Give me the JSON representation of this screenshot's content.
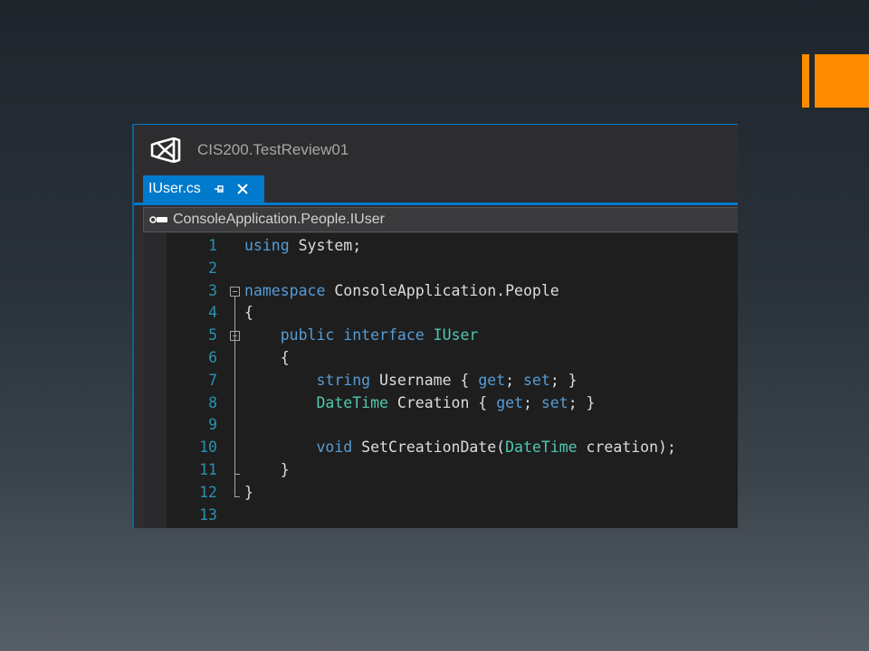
{
  "colors": {
    "accent": "#ff8c00",
    "keyword": "#569cd6",
    "type": "#4ec9b0",
    "line_number": "#2b91af",
    "text": "#dcdcdc",
    "tab_active": "#007acc"
  },
  "window": {
    "title": "CIS200.TestReview01",
    "logo_icon": "visual-studio-logo-icon"
  },
  "tab": {
    "label": "IUser.cs",
    "pin_icon": "pin-icon",
    "close_icon": "close-icon"
  },
  "nav": {
    "icon": "interface-icon",
    "path": "ConsoleApplication.People.IUser"
  },
  "code": {
    "lines": [
      {
        "n": "1",
        "tokens": [
          [
            "kw",
            "using"
          ],
          [
            "t",
            " System;"
          ]
        ]
      },
      {
        "n": "2",
        "tokens": []
      },
      {
        "n": "3",
        "tokens": [
          [
            "kw",
            "namespace"
          ],
          [
            "t",
            " ConsoleApplication.People"
          ]
        ]
      },
      {
        "n": "4",
        "tokens": [
          [
            "t",
            "{"
          ]
        ]
      },
      {
        "n": "5",
        "tokens": [
          [
            "t",
            "    "
          ],
          [
            "kw",
            "public"
          ],
          [
            "t",
            " "
          ],
          [
            "kw",
            "interface"
          ],
          [
            "t",
            " "
          ],
          [
            "type",
            "IUser"
          ]
        ]
      },
      {
        "n": "6",
        "tokens": [
          [
            "t",
            "    {"
          ]
        ]
      },
      {
        "n": "7",
        "tokens": [
          [
            "t",
            "        "
          ],
          [
            "kw",
            "string"
          ],
          [
            "t",
            " Username { "
          ],
          [
            "kw",
            "get"
          ],
          [
            "t",
            "; "
          ],
          [
            "kw",
            "set"
          ],
          [
            "t",
            "; }"
          ]
        ]
      },
      {
        "n": "8",
        "tokens": [
          [
            "t",
            "        "
          ],
          [
            "type",
            "DateTime"
          ],
          [
            "t",
            " Creation { "
          ],
          [
            "kw",
            "get"
          ],
          [
            "t",
            "; "
          ],
          [
            "kw",
            "set"
          ],
          [
            "t",
            "; }"
          ]
        ]
      },
      {
        "n": "9",
        "tokens": []
      },
      {
        "n": "10",
        "tokens": [
          [
            "t",
            "        "
          ],
          [
            "kw",
            "void"
          ],
          [
            "t",
            " SetCreationDate("
          ],
          [
            "type",
            "DateTime"
          ],
          [
            "t",
            " creation);"
          ]
        ]
      },
      {
        "n": "11",
        "tokens": [
          [
            "t",
            "    }"
          ]
        ]
      },
      {
        "n": "12",
        "tokens": [
          [
            "t",
            "}"
          ]
        ]
      },
      {
        "n": "13",
        "tokens": []
      }
    ]
  }
}
